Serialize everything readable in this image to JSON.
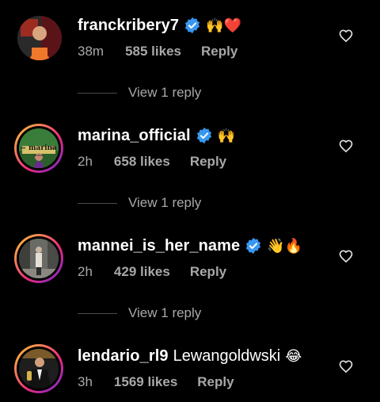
{
  "comments": [
    {
      "username": "franckribery7",
      "text": "",
      "emojis": "🙌❤️",
      "time": "38m",
      "likes": "585 likes",
      "reply_label": "Reply",
      "view_replies": "View 1 reply",
      "avatar_icon": "avatar-orange-shirt"
    },
    {
      "username": "marina_official",
      "text": "",
      "emojis": "🙌",
      "time": "2h",
      "likes": "658 likes",
      "reply_label": "Reply",
      "view_replies": "View 1 reply",
      "avatar_text": "marina",
      "avatar_small_left": "ow",
      "avatar_small_right": "the",
      "avatar_small_bottom": "dexico"
    },
    {
      "username": "mannei_is_her_name",
      "text": "",
      "emojis": "👋🔥",
      "time": "2h",
      "likes": "429 likes",
      "reply_label": "Reply",
      "view_replies": "View 1 reply",
      "avatar_icon": "avatar-street-photo"
    },
    {
      "username": "lendario_rl9",
      "text": "Lewangoldwski",
      "emojis": "😂",
      "time": "3h",
      "likes": "1569 likes",
      "reply_label": "Reply",
      "avatar_icon": "avatar-trophy-photo"
    }
  ],
  "colors": {
    "verified": "#3897f0",
    "muted": "#a8a8a8",
    "background": "#000000"
  }
}
